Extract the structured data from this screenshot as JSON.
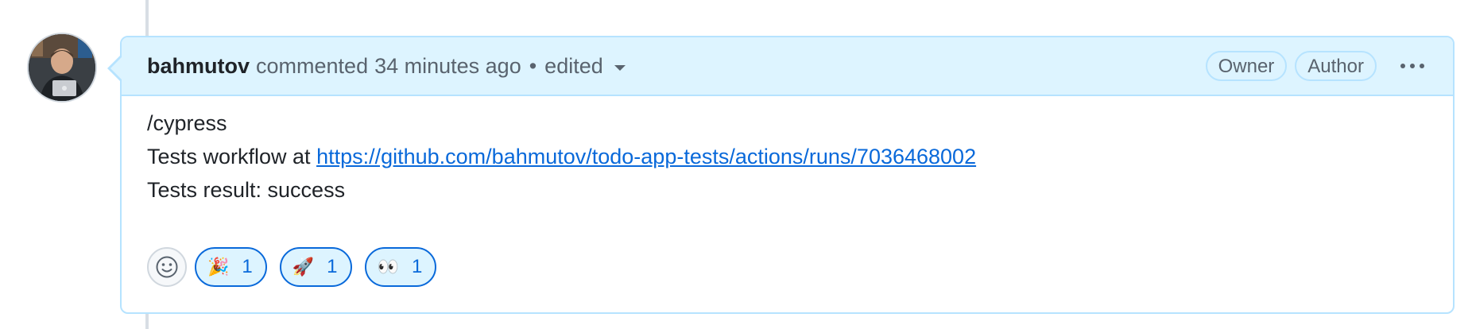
{
  "comment": {
    "author": "bahmutov",
    "action": "commented",
    "time": "34 minutes ago",
    "separator": "•",
    "edited_label": "edited",
    "labels": [
      "Owner",
      "Author"
    ],
    "body": {
      "line1": "/cypress",
      "line2_prefix": "Tests workflow at ",
      "link": "https://github.com/bahmutov/todo-app-tests/actions/runs/7036468002",
      "line3": "Tests result: success"
    },
    "reactions": [
      {
        "name": "tada",
        "emoji": "🎉",
        "count": "1"
      },
      {
        "name": "rocket",
        "emoji": "🚀",
        "count": "1"
      },
      {
        "name": "eyes",
        "emoji": "👀",
        "count": "1"
      }
    ]
  },
  "colors": {
    "header_bg": "#ddf4ff",
    "border": "#b6e3ff",
    "link": "#0969da",
    "muted": "#59636e"
  },
  "icons": {
    "add_reaction": "smiley-icon",
    "menu": "kebab-horizontal-icon",
    "edited_menu": "triangle-down-icon"
  }
}
